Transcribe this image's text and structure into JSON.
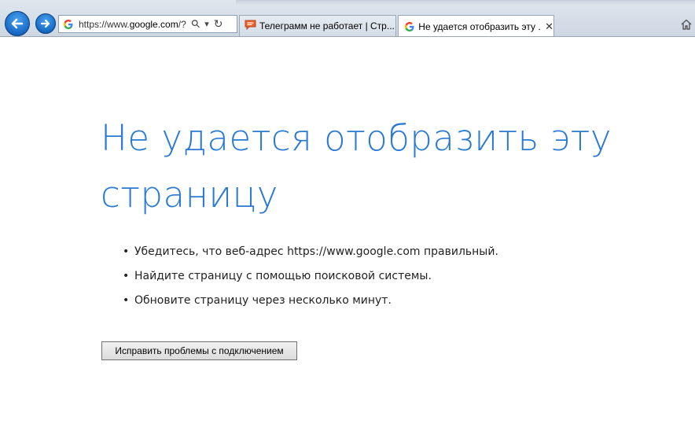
{
  "toolbar": {
    "address_prefix": "https://www.",
    "address_domain": "google.com",
    "address_suffix": "/?",
    "search_glyph": "⚲",
    "dropdown_glyph": "▾",
    "refresh_glyph": "↻"
  },
  "tabs": [
    {
      "title": "Телеграмм не работает | Стр...",
      "icon": "speech-bubble-icon",
      "active": false
    },
    {
      "title": "Не удается отобразить эту ...",
      "icon": "google-g-icon",
      "active": true,
      "close": "✕"
    }
  ],
  "page": {
    "title": "Не удается отобразить эту страницу",
    "tips": [
      "Убедитесь, что веб-адрес https://www.google.com правильный.",
      "Найдите страницу с помощью поисковой системы.",
      "Обновите страницу через несколько минут."
    ],
    "bullet": "•",
    "fix_button": "Исправить проблемы с подключением"
  },
  "colors": {
    "title": "#2a7ad4",
    "nav_button": "#1769c4",
    "accent_orange": "#e8622a"
  }
}
